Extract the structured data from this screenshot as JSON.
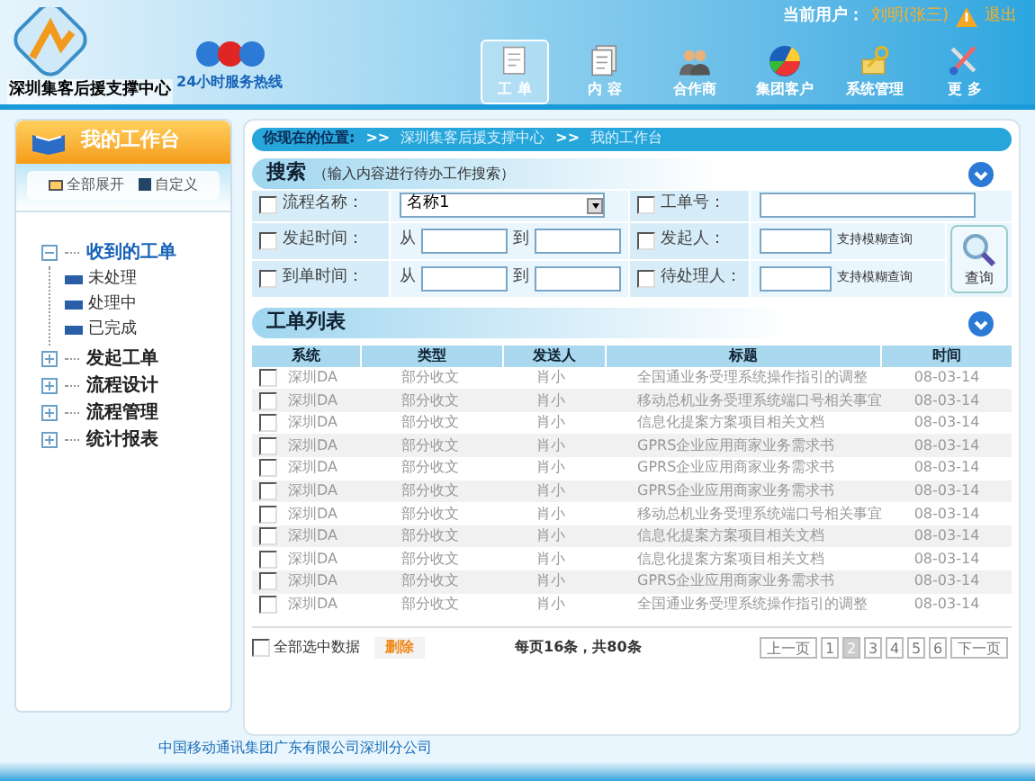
{
  "header": {
    "org_name": "深圳集客后援支撑中心",
    "hotline": "24小时服务热线",
    "user_label": "当前用户：",
    "user_name": "刘明(张三)",
    "logout": "退出"
  },
  "nav": [
    {
      "label": "工 单",
      "kind": "document",
      "selected": true
    },
    {
      "label": "内 容",
      "kind": "pages",
      "selected": false
    },
    {
      "label": "合作商",
      "kind": "people",
      "selected": false
    },
    {
      "label": "集团客户",
      "kind": "pie",
      "selected": false
    },
    {
      "label": "系统管理",
      "kind": "keys",
      "selected": false
    },
    {
      "label": "更 多",
      "kind": "tools",
      "selected": false
    }
  ],
  "sidebar": {
    "title": "我的工作台",
    "expand_all": "全部展开",
    "customize": "自定义",
    "tree": [
      {
        "label": "收到的工单",
        "expanded": true,
        "selected": true,
        "children": [
          {
            "label": "未处理"
          },
          {
            "label": "处理中"
          },
          {
            "label": "已完成"
          }
        ]
      },
      {
        "label": "发起工单",
        "expanded": false,
        "selected": false
      },
      {
        "label": "流程设计",
        "expanded": false,
        "selected": false
      },
      {
        "label": "流程管理",
        "expanded": false,
        "selected": false
      },
      {
        "label": "统计报表",
        "expanded": false,
        "selected": false
      }
    ]
  },
  "breadcrumb": {
    "label": "你现在的位置:",
    "separator": ">>",
    "items": [
      "深圳集客后援支撑中心",
      "我的工作台"
    ]
  },
  "search": {
    "title": "搜索",
    "hint": "（输入内容进行待办工作搜索）",
    "query": "查询",
    "fields": [
      {
        "label": "流程名称：",
        "checked": false,
        "kind": "select",
        "value": "名称1"
      },
      {
        "label": "工单号：",
        "checked": false,
        "kind": "text"
      },
      {
        "label": "发起时间：",
        "checked": false,
        "kind": "range",
        "from": "从",
        "to": "到"
      },
      {
        "label": "发起人：",
        "checked": false,
        "kind": "fuzzy",
        "note": "支持模糊查询"
      },
      {
        "label": "到单时间：",
        "checked": false,
        "kind": "range",
        "from": "从",
        "to": "到"
      },
      {
        "label": "待处理人：",
        "checked": false,
        "kind": "fuzzy",
        "note": "支持模糊查询"
      }
    ]
  },
  "table": {
    "title": "工单列表",
    "columns": [
      "系统",
      "类型",
      "发送人",
      "标题",
      "时间"
    ],
    "rows": [
      {
        "checked": false,
        "cells": [
          "深圳DA",
          "部分收文",
          "肖小",
          "全国通业务受理系统操作指引的调整",
          "08-03-14"
        ]
      },
      {
        "checked": false,
        "cells": [
          "深圳DA",
          "部分收文",
          "肖小",
          "移动总机业务受理系统端口号相关事宜",
          "08-03-14"
        ]
      },
      {
        "checked": false,
        "cells": [
          "深圳DA",
          "部分收文",
          "肖小",
          "信息化提案方案项目相关文档",
          "08-03-14"
        ]
      },
      {
        "checked": false,
        "cells": [
          "深圳DA",
          "部分收文",
          "肖小",
          "GPRS企业应用商家业务需求书",
          "08-03-14"
        ]
      },
      {
        "checked": false,
        "cells": [
          "深圳DA",
          "部分收文",
          "肖小",
          "GPRS企业应用商家业务需求书",
          "08-03-14"
        ]
      },
      {
        "checked": false,
        "cells": [
          "深圳DA",
          "部分收文",
          "肖小",
          "GPRS企业应用商家业务需求书",
          "08-03-14"
        ]
      },
      {
        "checked": false,
        "cells": [
          "深圳DA",
          "部分收文",
          "肖小",
          "移动总机业务受理系统端口号相关事宜",
          "08-03-14"
        ]
      },
      {
        "checked": false,
        "cells": [
          "深圳DA",
          "部分收文",
          "肖小",
          "信息化提案方案项目相关文档",
          "08-03-14"
        ]
      },
      {
        "checked": false,
        "cells": [
          "深圳DA",
          "部分收文",
          "肖小",
          "信息化提案方案项目相关文档",
          "08-03-14"
        ]
      },
      {
        "checked": false,
        "cells": [
          "深圳DA",
          "部分收文",
          "肖小",
          "GPRS企业应用商家业务需求书",
          "08-03-14"
        ]
      },
      {
        "checked": false,
        "cells": [
          "深圳DA",
          "部分收文",
          "肖小",
          "全国通业务受理系统操作指引的调整",
          "08-03-14"
        ]
      }
    ]
  },
  "footer_bar": {
    "select_all": "全部选中数据",
    "select_all_checked": false,
    "delete": "删除",
    "summary": "每页16条，共80条",
    "prev": "上一页",
    "next": "下一页",
    "pages": [
      {
        "label": "1",
        "selected": false
      },
      {
        "label": "2",
        "selected": true
      },
      {
        "label": "3",
        "selected": false
      },
      {
        "label": "4",
        "selected": false
      },
      {
        "label": "5",
        "selected": false
      },
      {
        "label": "6",
        "selected": false
      }
    ]
  },
  "copyright": "中国移动通讯集团广东有限公司深圳分公司"
}
